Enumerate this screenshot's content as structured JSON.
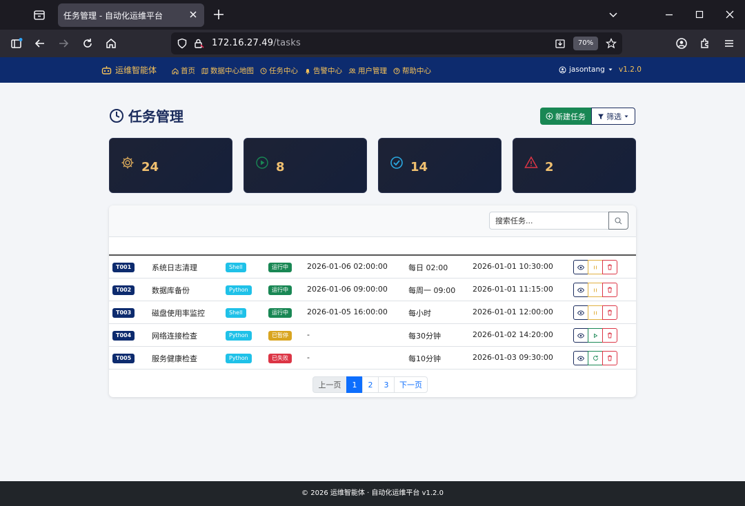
{
  "browser": {
    "tab_title": "任务管理 - 自动化运维平台",
    "url_host": "172.16.27.49",
    "url_path": "/tasks",
    "zoom": "70%"
  },
  "nav": {
    "brand": "运维智能体",
    "links": [
      "首页",
      "数据中心地图",
      "任务中心",
      "告警中心",
      "用户管理",
      "帮助中心"
    ],
    "user": "jasontang",
    "version": "v1.2.0"
  },
  "page": {
    "title": "任务管理",
    "new_button": "新建任务",
    "filter_button": "筛选"
  },
  "stats": [
    {
      "value": "24",
      "icon": "gear-icon",
      "color": "#d9a85a"
    },
    {
      "value": "8",
      "icon": "play-circle-icon",
      "color": "#198754"
    },
    {
      "value": "14",
      "icon": "check-circle-icon",
      "color": "#2aa8e0"
    },
    {
      "value": "2",
      "icon": "warning-triangle-icon",
      "color": "#dc3545"
    }
  ],
  "search": {
    "placeholder": "搜索任务..."
  },
  "tasks": [
    {
      "id": "T001",
      "name": "系统日志清理",
      "type": "Shell",
      "status": "运行中",
      "status_color": "#198754",
      "next_run": "2026-01-06 02:00:00",
      "schedule": "每日 02:00",
      "created": "2026-01-01 10:30:00",
      "action2": "pause"
    },
    {
      "id": "T002",
      "name": "数据库备份",
      "type": "Python",
      "status": "运行中",
      "status_color": "#198754",
      "next_run": "2026-01-06 09:00:00",
      "schedule": "每周一 09:00",
      "created": "2026-01-01 11:15:00",
      "action2": "pause"
    },
    {
      "id": "T003",
      "name": "磁盘使用率监控",
      "type": "Shell",
      "status": "运行中",
      "status_color": "#198754",
      "next_run": "2026-01-05 16:00:00",
      "schedule": "每小时",
      "created": "2026-01-01 12:00:00",
      "action2": "pause"
    },
    {
      "id": "T004",
      "name": "网络连接检查",
      "type": "Python",
      "status": "已暂停",
      "status_color": "#d9a520",
      "next_run": "-",
      "schedule": "每30分钟",
      "created": "2026-01-02 14:20:00",
      "action2": "play"
    },
    {
      "id": "T005",
      "name": "服务健康检查",
      "type": "Python",
      "status": "已失败",
      "status_color": "#dc3545",
      "next_run": "-",
      "schedule": "每10分钟",
      "created": "2026-01-03 09:30:00",
      "action2": "retry"
    }
  ],
  "pagination": {
    "prev": "上一页",
    "pages": [
      "1",
      "2",
      "3"
    ],
    "active": "1",
    "next": "下一页"
  },
  "footer": "© 2026 运维智能体 · 自动化运维平台 v1.2.0"
}
